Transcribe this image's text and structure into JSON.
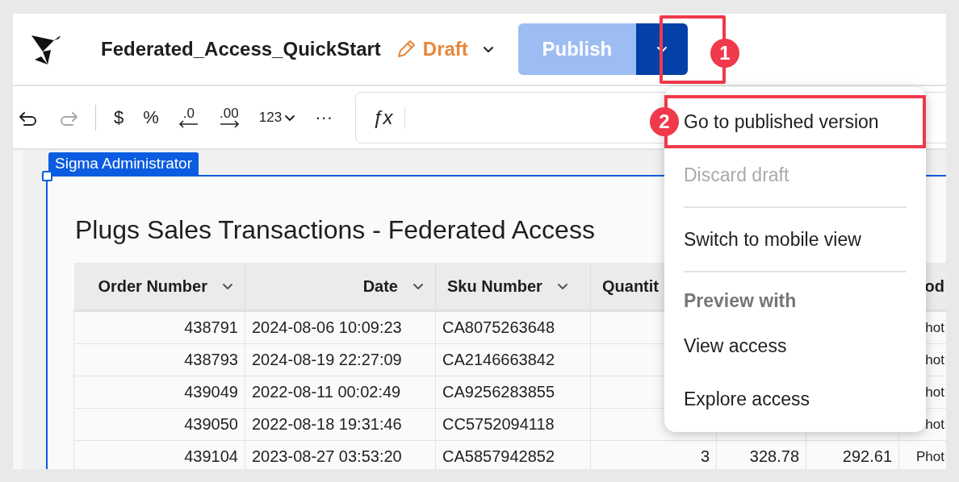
{
  "header": {
    "title": "Federated_Access_QuickStart",
    "status": "Draft",
    "publish": {
      "label": "Publish",
      "annotation": "1"
    }
  },
  "toolbar": {
    "items": [
      {
        "kind": "undo",
        "disabled": false
      },
      {
        "kind": "redo",
        "disabled": true
      },
      {
        "kind": "separator"
      },
      {
        "kind": "glyph",
        "label": "$"
      },
      {
        "kind": "glyph",
        "label": "%"
      },
      {
        "kind": "decrease_decimals",
        "label": ".0"
      },
      {
        "kind": "increase_decimals",
        "label": ".00"
      },
      {
        "kind": "dropdown",
        "label": "123"
      },
      {
        "kind": "glyph",
        "label": "···"
      }
    ],
    "formula_label": "ƒx"
  },
  "element_tag": "Sigma Administrator",
  "card": {
    "title": "Plugs Sales Transactions - Federated Access"
  },
  "table": {
    "columns": [
      {
        "label": "Order Number",
        "menu": true
      },
      {
        "label": "Date",
        "menu": true
      },
      {
        "label": "Sku Number",
        "menu": true
      },
      {
        "label": "Quantit"
      },
      {},
      {},
      {
        "label": "od",
        "menu": false
      }
    ],
    "rows": [
      {
        "cells": [
          "438791",
          "2024-08-06 10:09:23",
          "CA8075263648",
          null,
          null,
          null,
          "hot"
        ]
      },
      {
        "cells": [
          "438793",
          "2024-08-19 22:27:09",
          "CA2146663842",
          null,
          null,
          null,
          "hot"
        ]
      },
      {
        "cells": [
          "439049",
          "2022-08-11 00:02:49",
          "CA9256283855",
          null,
          null,
          null,
          "hot"
        ]
      },
      {
        "cells": [
          "439050",
          "2022-08-18 19:31:46",
          "CC5752094118",
          null,
          null,
          null,
          "hot"
        ]
      },
      {
        "cells": [
          "439104",
          "2023-08-27 03:53:20",
          "CA5857942852",
          "3",
          "328.78",
          "292.61",
          "Phot"
        ]
      }
    ]
  },
  "menu": {
    "items": [
      {
        "kind": "item",
        "label": "Go to published version",
        "disabled": false,
        "annotation": "2"
      },
      {
        "kind": "item",
        "label": "Discard draft",
        "disabled": true
      },
      {
        "kind": "divider"
      },
      {
        "kind": "item",
        "label": "Switch to mobile view",
        "disabled": false
      },
      {
        "kind": "divider"
      },
      {
        "kind": "section",
        "label": "Preview with"
      },
      {
        "kind": "item",
        "label": "View access",
        "disabled": false
      },
      {
        "kind": "item",
        "label": "Explore access",
        "disabled": false
      }
    ]
  }
}
